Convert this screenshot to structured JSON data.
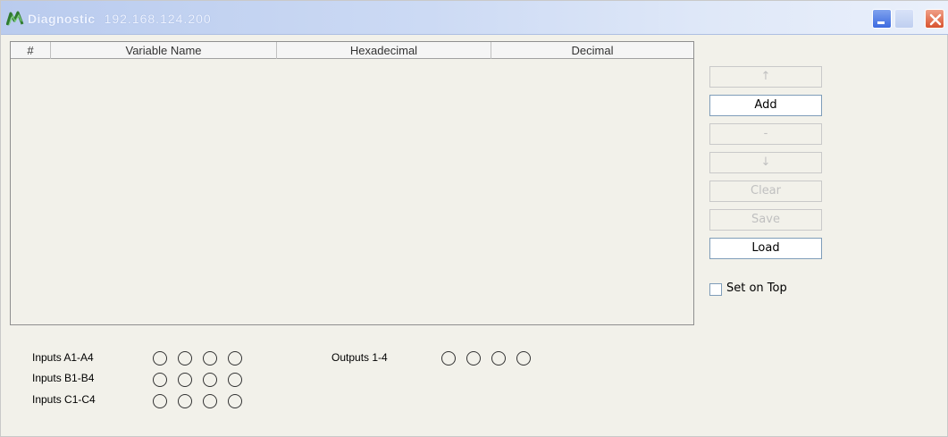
{
  "window": {
    "title": "Diagnostic",
    "ip": "192.168.124.200"
  },
  "table": {
    "columns": [
      "#",
      "Variable Name",
      "Hexadecimal",
      "Decimal"
    ],
    "rows": []
  },
  "buttons": {
    "up": "↑",
    "add": "Add",
    "delete": "-",
    "down": "↓",
    "clear": "Clear",
    "save": "Save",
    "load": "Load"
  },
  "set_on_top": {
    "label": "Set on Top",
    "checked": false
  },
  "io": {
    "inputs_a": "Inputs A1-A4",
    "inputs_b": "Inputs B1-B4",
    "inputs_c": "Inputs C1-C4",
    "outputs": "Outputs 1-4",
    "states": {
      "inputs_a": [
        false,
        false,
        false,
        false
      ],
      "inputs_b": [
        false,
        false,
        false,
        false
      ],
      "inputs_c": [
        false,
        false,
        false,
        false
      ],
      "outputs": [
        false,
        false,
        false,
        false
      ]
    }
  },
  "colors": {
    "titlebar_start": "#b9cbee",
    "enabled_border": "#7f9db9",
    "disabled_text": "#c0c0c0"
  }
}
